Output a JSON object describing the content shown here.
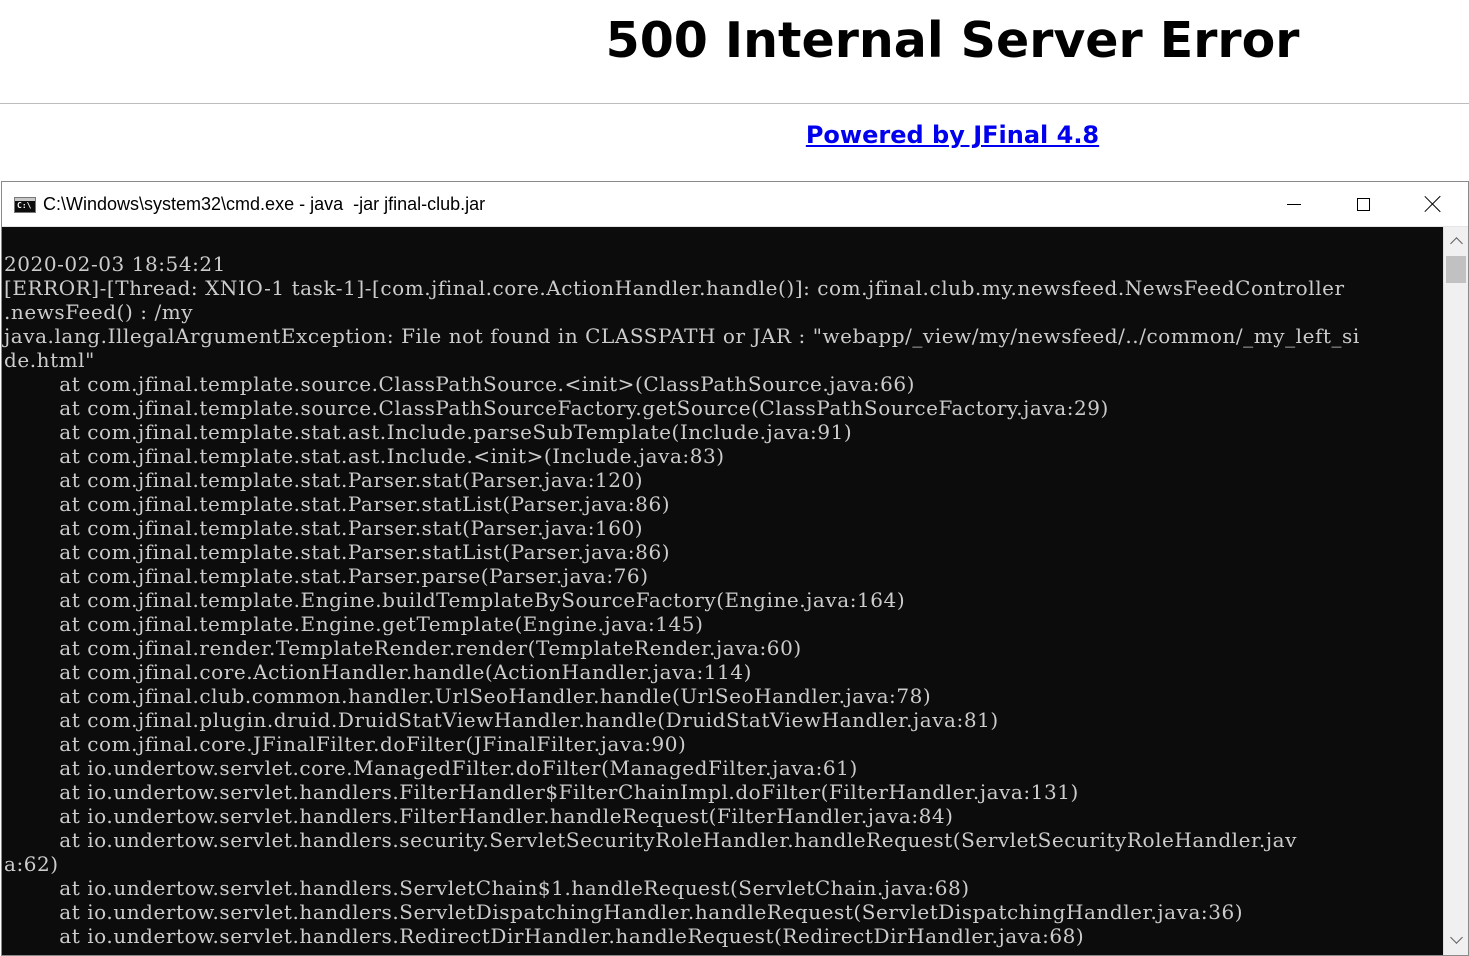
{
  "page": {
    "title": "500 Internal Server Error",
    "powered_by": "Powered by JFinal 4.8"
  },
  "window": {
    "title": "C:\\Windows\\system32\\cmd.exe - java  -jar jfinal-club.jar",
    "icon": "cmd-icon",
    "icon_text": "C:\\",
    "buttons": [
      "minimize-icon",
      "maximize-icon",
      "close-icon"
    ]
  },
  "console": {
    "background": "#0c0c0c",
    "foreground": "#cccccc",
    "lines": [
      "2020-02-03 18:54:21",
      "[ERROR]-[Thread: XNIO-1 task-1]-[com.jfinal.core.ActionHandler.handle()]: com.jfinal.club.my.newsfeed.NewsFeedController",
      ".newsFeed() : /my",
      "java.lang.IllegalArgumentException: File not found in CLASSPATH or JAR : \"webapp/_view/my/newsfeed/../common/_my_left_si",
      "de.html\"",
      "        at com.jfinal.template.source.ClassPathSource.<init>(ClassPathSource.java:66)",
      "        at com.jfinal.template.source.ClassPathSourceFactory.getSource(ClassPathSourceFactory.java:29)",
      "        at com.jfinal.template.stat.ast.Include.parseSubTemplate(Include.java:91)",
      "        at com.jfinal.template.stat.ast.Include.<init>(Include.java:83)",
      "        at com.jfinal.template.stat.Parser.stat(Parser.java:120)",
      "        at com.jfinal.template.stat.Parser.statList(Parser.java:86)",
      "        at com.jfinal.template.stat.Parser.stat(Parser.java:160)",
      "        at com.jfinal.template.stat.Parser.statList(Parser.java:86)",
      "        at com.jfinal.template.stat.Parser.parse(Parser.java:76)",
      "        at com.jfinal.template.Engine.buildTemplateBySourceFactory(Engine.java:164)",
      "        at com.jfinal.template.Engine.getTemplate(Engine.java:145)",
      "        at com.jfinal.render.TemplateRender.render(TemplateRender.java:60)",
      "        at com.jfinal.core.ActionHandler.handle(ActionHandler.java:114)",
      "        at com.jfinal.club.common.handler.UrlSeoHandler.handle(UrlSeoHandler.java:78)",
      "        at com.jfinal.plugin.druid.DruidStatViewHandler.handle(DruidStatViewHandler.java:81)",
      "        at com.jfinal.core.JFinalFilter.doFilter(JFinalFilter.java:90)",
      "        at io.undertow.servlet.core.ManagedFilter.doFilter(ManagedFilter.java:61)",
      "        at io.undertow.servlet.handlers.FilterHandler$FilterChainImpl.doFilter(FilterHandler.java:131)",
      "        at io.undertow.servlet.handlers.FilterHandler.handleRequest(FilterHandler.java:84)",
      "        at io.undertow.servlet.handlers.security.ServletSecurityRoleHandler.handleRequest(ServletSecurityRoleHandler.jav",
      "a:62)",
      "        at io.undertow.servlet.handlers.ServletChain$1.handleRequest(ServletChain.java:68)",
      "        at io.undertow.servlet.handlers.ServletDispatchingHandler.handleRequest(ServletDispatchingHandler.java:36)",
      "        at io.undertow.servlet.handlers.RedirectDirHandler.handleRequest(RedirectDirHandler.java:68)"
    ]
  },
  "scrollbar": {
    "up": "chevron-up-icon",
    "down": "chevron-down-icon",
    "position": 0.0
  },
  "colors": {
    "link": "#0000ee",
    "console_bg": "#0c0c0c",
    "console_text": "#cccccc"
  }
}
